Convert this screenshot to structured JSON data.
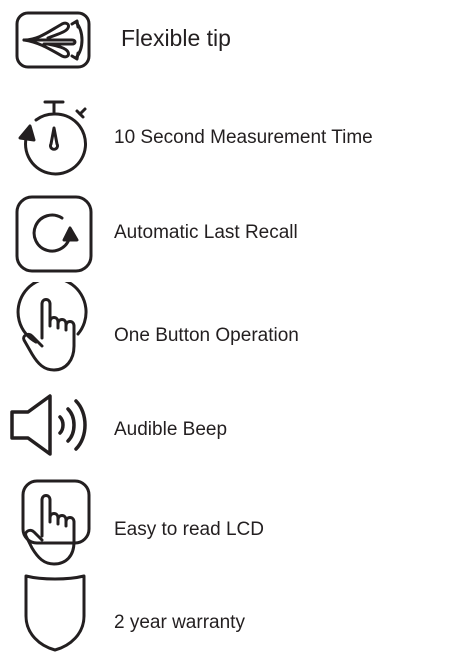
{
  "features": [
    {
      "icon": "flexible-tip-icon",
      "label": "Flexible tip"
    },
    {
      "icon": "stopwatch-icon",
      "label": "10 Second Measurement Time"
    },
    {
      "icon": "recall-arrow-icon",
      "label": "Automatic Last Recall"
    },
    {
      "icon": "pointing-hand-icon",
      "label": "One Button Operation"
    },
    {
      "icon": "speaker-icon",
      "label": "Audible Beep"
    },
    {
      "icon": "pointing-hand-icon",
      "label": "Easy to read LCD"
    },
    {
      "icon": "shield-icon",
      "label": "2 year warranty"
    }
  ],
  "colors": {
    "text": "#231f20",
    "icon_stroke": "#231f20",
    "background": "#ffffff"
  }
}
